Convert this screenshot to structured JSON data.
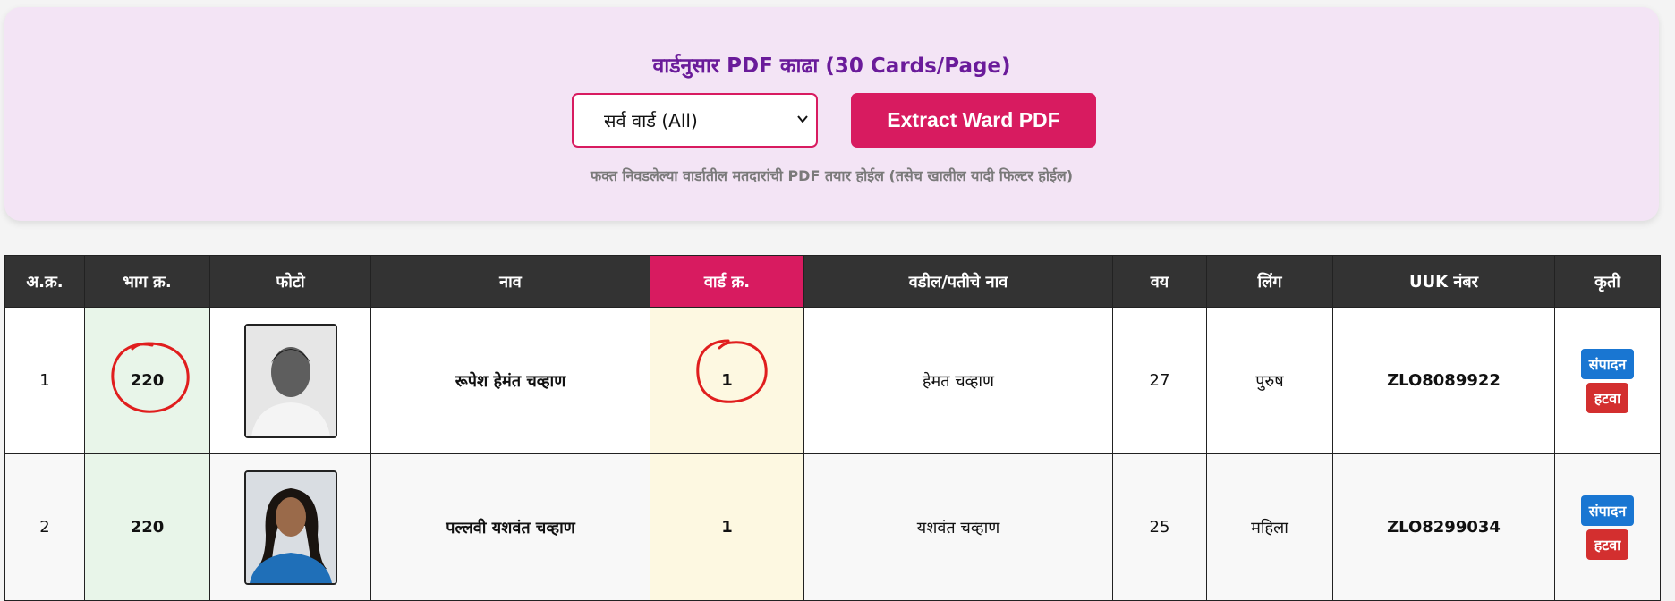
{
  "panel": {
    "title": "वार्डनुसार PDF काढा (30 Cards/Page)",
    "ward_select_value": "सर्व वार्ड (All)",
    "extract_button_label": "Extract Ward PDF",
    "note": "फक्त निवडलेल्या वार्डातील मतदारांची PDF तयार होईल (तसेच खालील यादी फिल्टर होईल)"
  },
  "table": {
    "headers": [
      "अ.क्र.",
      "भाग क्र.",
      "फोटो",
      "नाव",
      "वार्ड क्र.",
      "वडील/पतीचे नाव",
      "वय",
      "लिंग",
      "UUK नंबर",
      "कृती"
    ],
    "rows": [
      {
        "serial": "1",
        "bhag": "220",
        "name": "रूपेश हेमंत चव्हाण",
        "ward": "1",
        "father_name": "हेमत चव्हाण",
        "age": "27",
        "gender": "पुरुष",
        "uuk": "ZLO8089922",
        "edit_label": "संपादन",
        "delete_label": "हटवा"
      },
      {
        "serial": "2",
        "bhag": "220",
        "name": "पल्लवी यशवंत चव्हाण",
        "ward": "1",
        "father_name": "यशवंत चव्हाण",
        "age": "25",
        "gender": "महिला",
        "uuk": "ZLO8299034",
        "edit_label": "संपादन",
        "delete_label": "हटवा"
      }
    ]
  },
  "colors": {
    "panel_bg": "#f3e4f5",
    "title": "#6a1b9a",
    "accent": "#d81b60",
    "header_bg": "#333333",
    "bhag_text": "#2e7d32",
    "uuk_text": "#d32f2f",
    "edit_button": "#1976d2",
    "delete_button": "#d32f2f",
    "annotation_circle": "#e01e1e"
  }
}
